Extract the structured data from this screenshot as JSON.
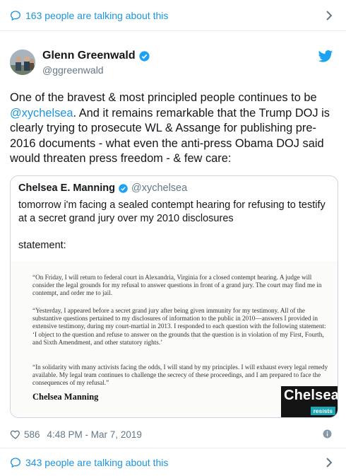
{
  "top_bar": {
    "text": "163 people are talking about this"
  },
  "tweet": {
    "name": "Glenn Greenwald",
    "handle": "@ggreenwald",
    "body_before": "One of the  bravest & most principled people continues to be ",
    "mention": "@xychelsea",
    "body_after": ". And it remains remarkable that the Trump DOJ is clearly trying to prosecute WL & Assange for publishing pre-2016 documents - what even the anti-press Obama DOJ said would threaten press freedom - & few care:"
  },
  "quote": {
    "name": "Chelsea E. Manning",
    "handle": "@xychelsea",
    "text": "tomorrow i'm facing a sealed contempt hearing for refusing to testify at a secret grand jury over my 2010 disclosures",
    "statement_label": "statement:",
    "image": {
      "p1": "“On Friday, I will return to federal court in Alexandria, Virginia for a closed contempt hearing. A judge will consider the legal grounds for my refusal to answer questions in front of a grand jury. The court may find me in contempt, and order me to jail.",
      "p2": "“Yesterday, I appeared before a secret grand jury after being given immunity for my testimony. All of the substantive questions pertained to my disclosures of information to the public in 2010—answers I provided in extensive testimony, during my court-martial in 2013. I responded to each question with the following statement: ‘I object to the question and refuse to answer on the grounds that the question is in violation of my First, Fourth, and Sixth Amendment, and other statutory rights.’",
      "p3": "“In solidarity with many activists facing the odds, I will stand by my principles. I will exhaust every legal remedy available. My legal team continues to challenge the secrecy of these proceedings, and I am prepared to face the consequences of my refusal.”",
      "signature": "Chelsea Manning",
      "brand_word": "Chelsea",
      "brand_tag": "resists"
    }
  },
  "footer": {
    "likes": "586",
    "timestamp": "4:48 PM - Mar 7, 2019"
  },
  "bottom_bar": {
    "text": "343 people are talking about this"
  },
  "colors": {
    "link": "#1b95e0",
    "muted": "#657786",
    "border": "#e6ecf0",
    "verified": "#1da1f2",
    "brand_teal": "#1aa7b3"
  },
  "icons": [
    "speech-bubble-icon",
    "chevron-right-icon",
    "verified-badge-icon",
    "twitter-bird-icon",
    "heart-icon",
    "info-icon"
  ]
}
